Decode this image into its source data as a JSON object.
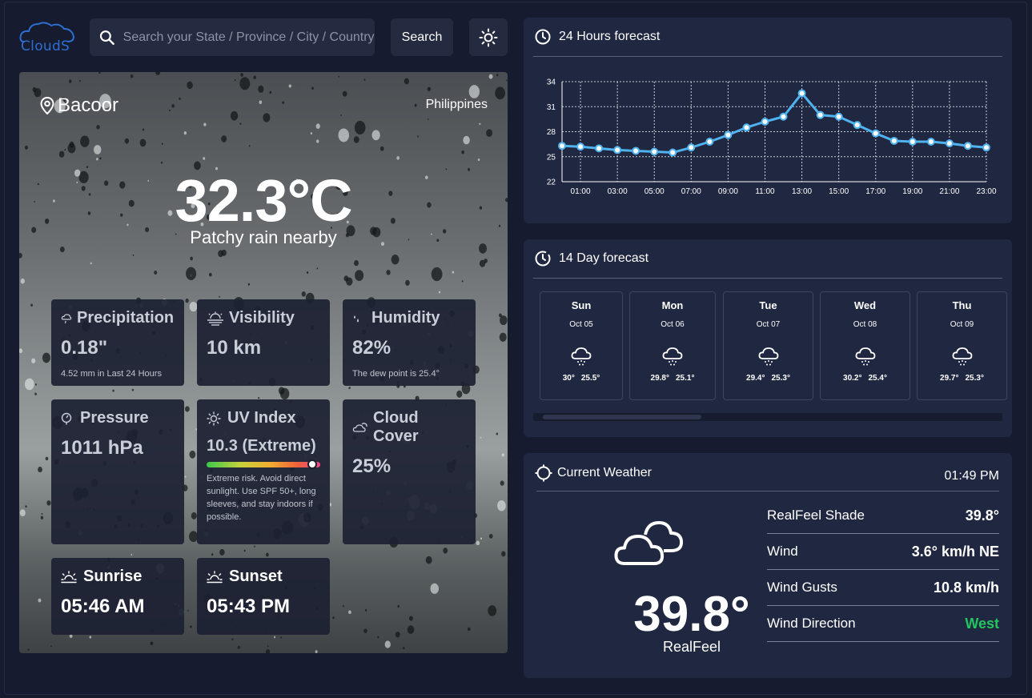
{
  "header": {
    "logo_text": "CloudS",
    "search_placeholder": "Search your State / Province / City / Country",
    "search_button": "Search",
    "theme_icon": "sun-icon"
  },
  "main": {
    "city": "Bacoor",
    "country": "Philippines",
    "temperature": "32.3°C",
    "condition": "Patchy rain nearby",
    "stats": {
      "precipitation": {
        "label": "Precipitation",
        "value": "0.18\"",
        "sub": "4.52 mm in Last 24 Hours"
      },
      "visibility": {
        "label": "Visibility",
        "value": "10 km"
      },
      "humidity": {
        "label": "Humidity",
        "value": "82%",
        "sub": "The dew point is 25.4°"
      },
      "pressure": {
        "label": "Pressure",
        "value": "1011 hPa"
      },
      "uv": {
        "label": "UV Index",
        "value": "10.3 (Extreme)",
        "level_fraction": 0.93,
        "sub": "Extreme risk. Avoid direct sunlight. Use SPF 50+, long sleeves, and stay indoors if possible."
      },
      "cloud": {
        "label": "Cloud Cover",
        "value": "25%"
      },
      "sunrise": {
        "label": "Sunrise",
        "value": "05:46 AM"
      },
      "sunset": {
        "label": "Sunset",
        "value": "05:43 PM"
      }
    }
  },
  "hourly": {
    "title": "24 Hours forecast"
  },
  "chart_data": {
    "type": "line",
    "x": [
      "00:00",
      "01:00",
      "02:00",
      "03:00",
      "04:00",
      "05:00",
      "06:00",
      "07:00",
      "08:00",
      "09:00",
      "10:00",
      "11:00",
      "12:00",
      "13:00",
      "14:00",
      "15:00",
      "16:00",
      "17:00",
      "18:00",
      "19:00",
      "20:00",
      "21:00",
      "22:00",
      "23:00"
    ],
    "x_tick_labels": [
      "01:00",
      "03:00",
      "05:00",
      "07:00",
      "09:00",
      "11:00",
      "13:00",
      "15:00",
      "17:00",
      "19:00",
      "21:00",
      "23:00"
    ],
    "series": [
      {
        "values": [
          26.3,
          26.2,
          26.0,
          25.8,
          25.7,
          25.6,
          25.5,
          26.1,
          26.8,
          27.6,
          28.5,
          29.2,
          29.8,
          32.6,
          30.0,
          29.8,
          28.8,
          27.8,
          26.9,
          26.8,
          26.8,
          26.6,
          26.3,
          26.1
        ]
      }
    ],
    "ylim": [
      22,
      34
    ],
    "y_ticks": [
      22,
      25,
      28,
      31,
      34
    ],
    "grid": true,
    "colors": {
      "line": "#4fb3f0",
      "grid": "#c9ced8",
      "axis": "#ffffff"
    }
  },
  "daily": {
    "title": "14 Day forecast",
    "days": [
      {
        "name": "Sun",
        "date": "Oct 05",
        "high": "30°",
        "low": "25.5°"
      },
      {
        "name": "Mon",
        "date": "Oct 06",
        "high": "29.8°",
        "low": "25.1°"
      },
      {
        "name": "Tue",
        "date": "Oct 07",
        "high": "29.4°",
        "low": "25.3°"
      },
      {
        "name": "Wed",
        "date": "Oct 08",
        "high": "30.2°",
        "low": "25.4°"
      },
      {
        "name": "Thu",
        "date": "Oct 09",
        "high": "29.7°",
        "low": "25.3°"
      }
    ]
  },
  "current": {
    "title": "Current Weather",
    "time": "01:49 PM",
    "realfeel_temp": "39.8°",
    "realfeel_label": "RealFeel",
    "rows": [
      {
        "label": "RealFeel Shade",
        "value": "39.8°"
      },
      {
        "label": "Wind",
        "value": "3.6° km/h NE"
      },
      {
        "label": "Wind Gusts",
        "value": "10.8 km/h"
      },
      {
        "label": "Wind Direction",
        "value": "West"
      }
    ],
    "accent_color": "#22c55e"
  }
}
